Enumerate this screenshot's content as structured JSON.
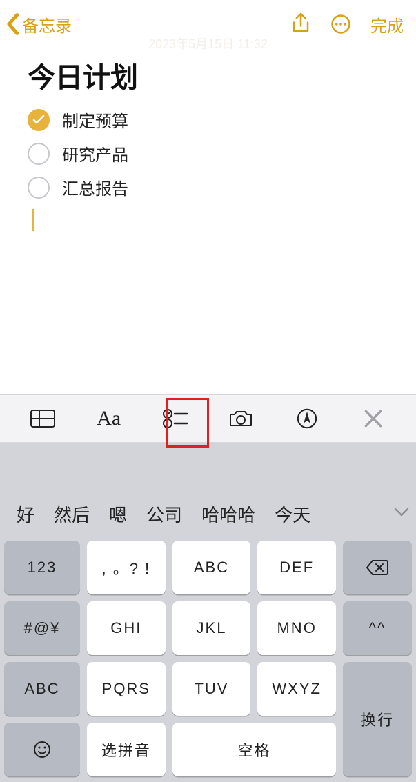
{
  "nav": {
    "back_label": "备忘录",
    "done_label": "完成",
    "timestamp_watermark": "2023年5月15日 11:32"
  },
  "note": {
    "title": "今日计划",
    "items": [
      {
        "text": "制定预算",
        "checked": true
      },
      {
        "text": "研究产品",
        "checked": false
      },
      {
        "text": "汇总报告",
        "checked": false
      }
    ]
  },
  "toolbar": {
    "aa_label": "Aa"
  },
  "suggestions": [
    "好",
    "然后",
    "嗯",
    "公司",
    "哈哈哈",
    "今天"
  ],
  "keyboard": {
    "num_toggle": "123",
    "punct": ", 。? !",
    "abc": "ABC",
    "def": "DEF",
    "sym": "#@¥",
    "ghi": "GHI",
    "jkl": "JKL",
    "mno": "MNO",
    "face": "^^",
    "abc_mode": "ABC",
    "pqrs": "PQRS",
    "tuv": "TUV",
    "wxyz": "WXYZ",
    "return": "换行",
    "pinyin": "选拼音",
    "space": "空格"
  }
}
